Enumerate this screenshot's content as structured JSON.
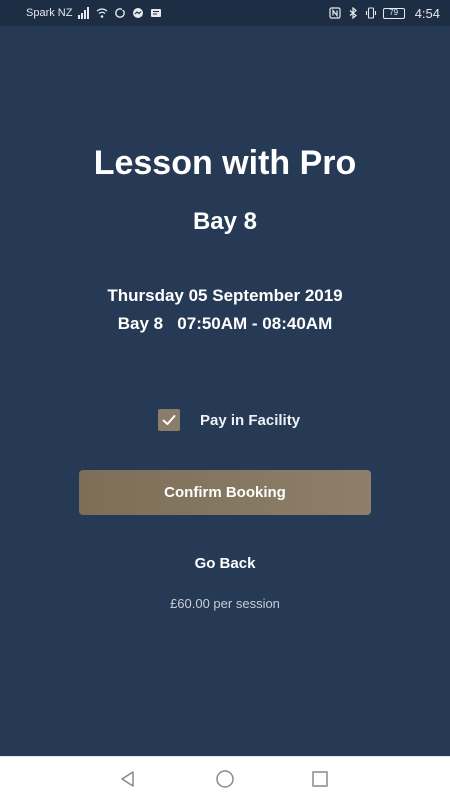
{
  "status_bar": {
    "carrier": "Spark NZ",
    "battery": "79",
    "time": "4:54"
  },
  "booking": {
    "title": "Lesson with Pro",
    "subtitle": "Bay 8",
    "date": "Thursday 05 September 2019",
    "slot": "Bay 8   07:50AM - 08:40AM"
  },
  "payment": {
    "pay_in_facility_label": "Pay in Facility",
    "pay_in_facility_checked": true
  },
  "actions": {
    "confirm_label": "Confirm Booking",
    "go_back_label": "Go Back"
  },
  "price_text": "£60.00 per session",
  "colors": {
    "background": "#263a55",
    "accent": "#8a7d6a",
    "text": "#ffffff"
  },
  "icons": {
    "status_left": [
      "signal-icon",
      "wifi-icon",
      "sync-icon",
      "messenger-icon",
      "message-icon"
    ],
    "status_right": [
      "nfc-icon",
      "bluetooth-icon",
      "vibrate-icon",
      "battery-icon"
    ],
    "nav": [
      "back-nav-icon",
      "home-nav-icon",
      "recents-nav-icon"
    ]
  }
}
